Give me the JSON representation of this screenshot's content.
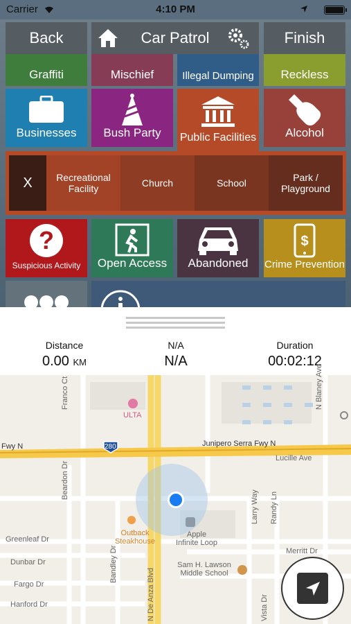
{
  "status_bar": {
    "carrier": "Carrier",
    "time": "4:10 PM"
  },
  "nav": {
    "back": "Back",
    "title": "Car Patrol",
    "finish": "Finish"
  },
  "tiles_row0": [
    "Graffiti",
    "Mischief",
    "Illegal Dumping",
    "Reckless"
  ],
  "tiles_row1": [
    "Businesses",
    "Bush Party",
    "Public Facilities",
    "Alcohol"
  ],
  "subcategories": {
    "close": "X",
    "items": [
      "Recreational Facility",
      "Church",
      "School",
      "Park / Playground"
    ]
  },
  "tiles_row3": [
    "Suspicious Activity",
    "Open Access",
    "Abandoned",
    "Crime Prevention"
  ],
  "stats": {
    "distance_label": "Distance",
    "distance_value": "0.00",
    "distance_unit": "KM",
    "na_label": "N/A",
    "na_value": "N/A",
    "duration_label": "Duration",
    "duration_value": "00:02:12"
  },
  "map": {
    "labels": {
      "ulta": "ULTA",
      "interstate": "280",
      "fwy_left": "Fwy N",
      "fwy_main": "Junipero Serra Fwy N",
      "lucille": "Lucille Ave",
      "blaney": "N Blaney Ave",
      "franco": "Franco Ct",
      "beardon": "Beardon Dr",
      "greenleaf": "Greenleaf Dr",
      "dunbar": "Dunbar Dr",
      "fargo": "Fargo Dr",
      "hanford": "Hanford Dr",
      "bandley": "Bandley Dr",
      "deanza": "N De Anza Blvd",
      "larry": "Larry Way",
      "randy": "Randy Ln",
      "merritt": "Merritt Dr",
      "vista": "Vista Dr",
      "outback": "Outback Steakhouse",
      "apple": "Apple Infinite Loop",
      "lawson": "Sam H. Lawson Middle School"
    }
  },
  "colors": {
    "graffiti": "#3e7d3b",
    "mischief": "#863c55",
    "dumping": "#2f5d88",
    "reckless": "#8a9d2f",
    "businesses": "#1f7fb0",
    "bush_party": "#8a2682",
    "public": "#b44a28",
    "alcohol": "#98413a",
    "suspicious": "#b0181b",
    "open_access": "#2e7a58",
    "abandoned": "#4b3442",
    "crime_prev": "#b78f1c"
  }
}
